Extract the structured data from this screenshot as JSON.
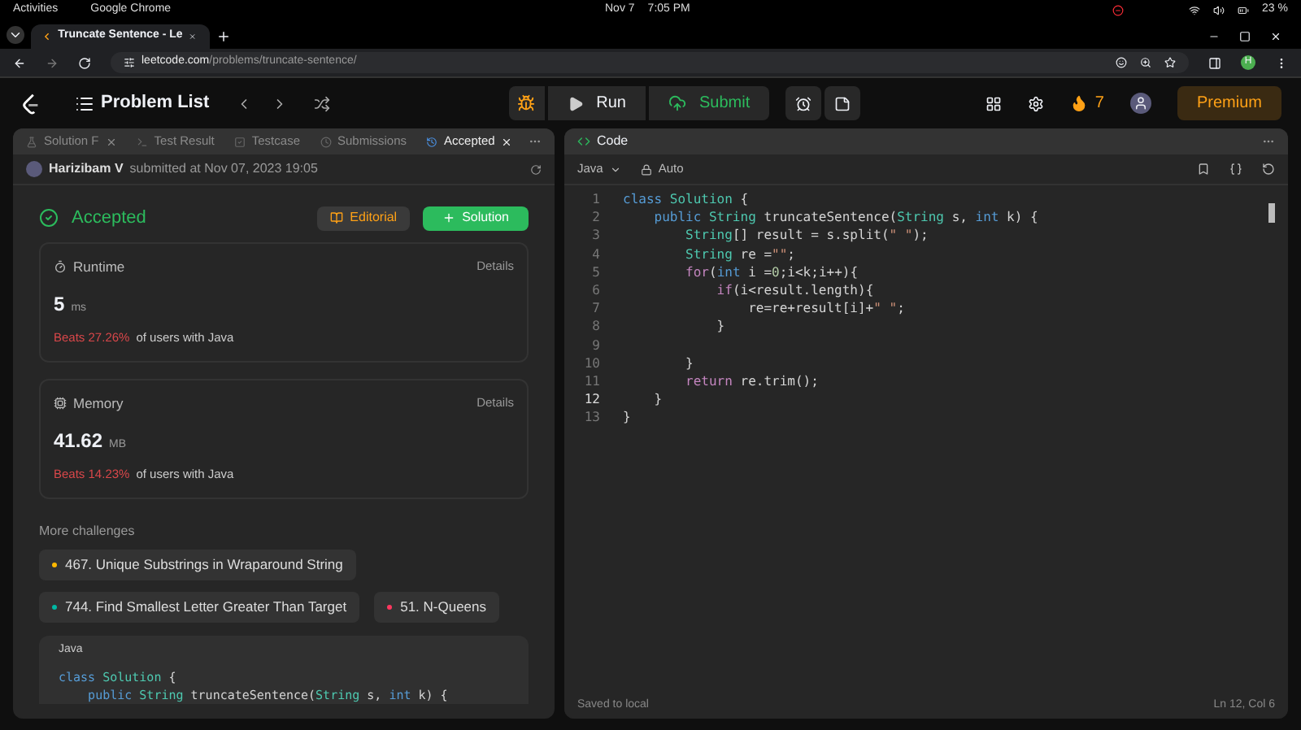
{
  "system_bar": {
    "activities": "Activities",
    "app": "Google Chrome",
    "date": "Nov 7",
    "time": "7:05 PM",
    "battery": "23 %"
  },
  "browser": {
    "tab_title": "Truncate Sentence - Le",
    "url_host": "leetcode.com",
    "url_path": "/problems/truncate-sentence/",
    "profile_initial": "H"
  },
  "nav": {
    "problem_list": "Problem List",
    "run": "Run",
    "submit": "Submit",
    "streak": "7",
    "premium": "Premium"
  },
  "left_tabs": [
    {
      "label": "Solution F",
      "closable": true,
      "selected": false
    },
    {
      "label": "Test Result",
      "closable": false,
      "selected": false
    },
    {
      "label": "Testcase",
      "closable": false,
      "selected": false
    },
    {
      "label": "Submissions",
      "closable": false,
      "selected": false
    },
    {
      "label": "Accepted",
      "closable": true,
      "selected": true
    }
  ],
  "submission": {
    "user": "Harizibam V",
    "meta": "submitted at Nov 07, 2023 19:05",
    "status": "Accepted",
    "editorial": "Editorial",
    "solution": "Solution"
  },
  "stats": [
    {
      "kind": "runtime",
      "title": "Runtime",
      "details": "Details",
      "value": "5",
      "unit": "ms",
      "beats": "Beats 27.26%",
      "suffix": "of users with Java"
    },
    {
      "kind": "memory",
      "title": "Memory",
      "details": "Details",
      "value": "41.62",
      "unit": "MB",
      "beats": "Beats 14.23%",
      "suffix": "of users with Java"
    }
  ],
  "more_challenges": {
    "title": "More challenges",
    "items": [
      {
        "label": "467. Unique Substrings in Wraparound String",
        "color": "#ffb800"
      },
      {
        "label": "744. Find Smallest Letter Greater Than Target",
        "color": "#00b8a3"
      },
      {
        "label": "51. N-Queens",
        "color": "#ff375f"
      }
    ]
  },
  "snippet": {
    "language": "Java",
    "lines": [
      [
        {
          "t": "class ",
          "kind": "kw"
        },
        {
          "t": "Solution",
          "kind": "type"
        },
        {
          "t": " {",
          "kind": "plain"
        }
      ],
      [
        {
          "t": "    public ",
          "kind": "kw"
        },
        {
          "t": "String ",
          "kind": "type"
        },
        {
          "t": "truncateSentence(",
          "kind": "plain"
        },
        {
          "t": "String ",
          "kind": "type"
        },
        {
          "t": "s, ",
          "kind": "plain"
        },
        {
          "t": "int ",
          "kind": "kw"
        },
        {
          "t": "k) {",
          "kind": "plain"
        }
      ]
    ]
  },
  "editor": {
    "title": "Code",
    "language": "Java",
    "mode": "Auto",
    "saved": "Saved to local",
    "position": "Ln 12, Col 6",
    "lines": [
      {
        "number": "1",
        "current": false,
        "tokens": [
          {
            "t": "class ",
            "kind": "kw"
          },
          {
            "t": "Solution",
            "kind": "type"
          },
          {
            "t": " {",
            "kind": "plain"
          }
        ]
      },
      {
        "number": "2",
        "current": false,
        "tokens": [
          {
            "t": "    public ",
            "kind": "kw"
          },
          {
            "t": "String ",
            "kind": "type"
          },
          {
            "t": "truncateSentence(",
            "kind": "plain"
          },
          {
            "t": "String ",
            "kind": "type"
          },
          {
            "t": "s, ",
            "kind": "plain"
          },
          {
            "t": "int ",
            "kind": "kw"
          },
          {
            "t": "k) {",
            "kind": "plain"
          }
        ]
      },
      {
        "number": "3",
        "current": false,
        "tokens": [
          {
            "t": "        String",
            "kind": "type"
          },
          {
            "t": "[] result = s.split(",
            "kind": "plain"
          },
          {
            "t": "\" \"",
            "kind": "str"
          },
          {
            "t": ");",
            "kind": "plain"
          }
        ]
      },
      {
        "number": "4",
        "current": false,
        "tokens": [
          {
            "t": "        String ",
            "kind": "type"
          },
          {
            "t": "re =",
            "kind": "plain"
          },
          {
            "t": "\"\"",
            "kind": "str"
          },
          {
            "t": ";",
            "kind": "plain"
          }
        ]
      },
      {
        "number": "5",
        "current": false,
        "tokens": [
          {
            "t": "        for",
            "kind": "ctrl"
          },
          {
            "t": "(",
            "kind": "plain"
          },
          {
            "t": "int ",
            "kind": "kw"
          },
          {
            "t": "i =",
            "kind": "plain"
          },
          {
            "t": "0",
            "kind": "num"
          },
          {
            "t": ";i<k;i++){",
            "kind": "plain"
          }
        ]
      },
      {
        "number": "6",
        "current": false,
        "tokens": [
          {
            "t": "            if",
            "kind": "ctrl"
          },
          {
            "t": "(i<result.length){",
            "kind": "plain"
          }
        ]
      },
      {
        "number": "7",
        "current": false,
        "tokens": [
          {
            "t": "                re=re+result[i]+",
            "kind": "plain"
          },
          {
            "t": "\" \"",
            "kind": "str"
          },
          {
            "t": ";",
            "kind": "plain"
          }
        ]
      },
      {
        "number": "8",
        "current": false,
        "tokens": [
          {
            "t": "            }",
            "kind": "plain"
          }
        ]
      },
      {
        "number": "9",
        "current": false
      },
      {
        "number": "10",
        "current": false,
        "tokens": [
          {
            "t": "        }",
            "kind": "plain"
          }
        ]
      },
      {
        "number": "11",
        "current": false,
        "tokens": [
          {
            "t": "        return ",
            "kind": "ctrl"
          },
          {
            "t": "re.trim();",
            "kind": "plain"
          }
        ]
      },
      {
        "number": "12",
        "current": true,
        "tokens": [
          {
            "t": "    }",
            "kind": "plain"
          }
        ]
      },
      {
        "number": "13",
        "current": false,
        "tokens": [
          {
            "t": "}",
            "kind": "plain"
          }
        ]
      }
    ]
  }
}
